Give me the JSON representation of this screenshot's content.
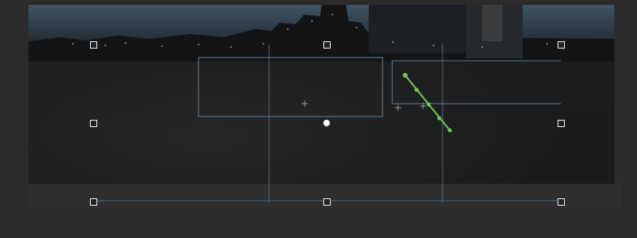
{
  "canvas": {
    "background": "#2b2b2b",
    "photo_tint": "#1a1a1a"
  },
  "colors": {
    "guide": "#4a6a82",
    "box_outline": "#5c7f98",
    "handle_border": "#f0f0f0",
    "path": "#72c45a",
    "pivot": "#ffffff",
    "crosshair": "#9a9a9a"
  },
  "icons": {
    "crosshair": "+",
    "transform_handle": "square-handle-icon",
    "anchor_point": "anchor-point-icon",
    "pivot": "pivot-dot-icon"
  }
}
